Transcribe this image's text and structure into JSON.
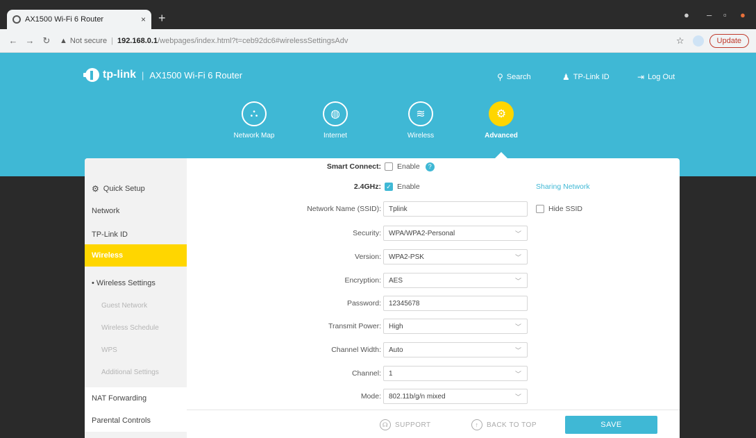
{
  "browser": {
    "tab_title": "AX1500 Wi-Fi 6 Router",
    "tab_close": "×",
    "new_tab": "+",
    "url_warning": "▲",
    "url_not_secure": "Not secure",
    "url_host": "192.168.0.1",
    "url_path": "/webpages/index.html?t=ceb92dc6#wirelessSettingsAdv",
    "update_label": "Update"
  },
  "header": {
    "brand": "tp-link",
    "product": "AX1500 Wi-Fi 6 Router",
    "search_label": "Search",
    "tplink_id_label": "TP-Link ID",
    "logout_label": "Log Out"
  },
  "main_nav": [
    {
      "label": "Network Map",
      "icon": "network-map-icon"
    },
    {
      "label": "Internet",
      "icon": "globe-icon"
    },
    {
      "label": "Wireless",
      "icon": "wifi-icon"
    },
    {
      "label": "Advanced",
      "icon": "gear-icon",
      "active": true
    }
  ],
  "sidebar": {
    "items": [
      {
        "label": "Quick Setup"
      },
      {
        "label": "Network"
      },
      {
        "label": "TP-Link ID"
      },
      {
        "label": "Wireless",
        "active": true
      },
      {
        "label": "• Wireless Settings"
      },
      {
        "label": "Guest Network"
      },
      {
        "label": "Wireless Schedule"
      },
      {
        "label": "WPS"
      },
      {
        "label": "Additional Settings"
      },
      {
        "label": "NAT Forwarding"
      },
      {
        "label": "Parental Controls"
      }
    ]
  },
  "form": {
    "smart_connect": {
      "label": "Smart Connect:",
      "option": "Enable",
      "checked": false
    },
    "band_24": {
      "label": "2.4GHz:",
      "option": "Enable",
      "checked": true,
      "sharing_link": "Sharing Network"
    },
    "ssid": {
      "label": "Network Name (SSID):",
      "value": "Tplink",
      "hide_label": "Hide SSID"
    },
    "security": {
      "label": "Security:",
      "value": "WPA/WPA2-Personal"
    },
    "version": {
      "label": "Version:",
      "value": "WPA2-PSK"
    },
    "encryption": {
      "label": "Encryption:",
      "value": "AES"
    },
    "password": {
      "label": "Password:",
      "value": "12345678"
    },
    "transmit_power": {
      "label": "Transmit Power:",
      "value": "High"
    },
    "channel_width": {
      "label": "Channel Width:",
      "value": "Auto"
    },
    "channel": {
      "label": "Channel:",
      "value": "1"
    },
    "mode": {
      "label": "Mode:",
      "value": "802.11b/g/n mixed"
    }
  },
  "footer": {
    "support_label": "SUPPORT",
    "back_to_top_label": "BACK TO TOP",
    "save_label": "SAVE"
  },
  "colors": {
    "accent": "#3fb8d5",
    "active": "#ffd600"
  }
}
